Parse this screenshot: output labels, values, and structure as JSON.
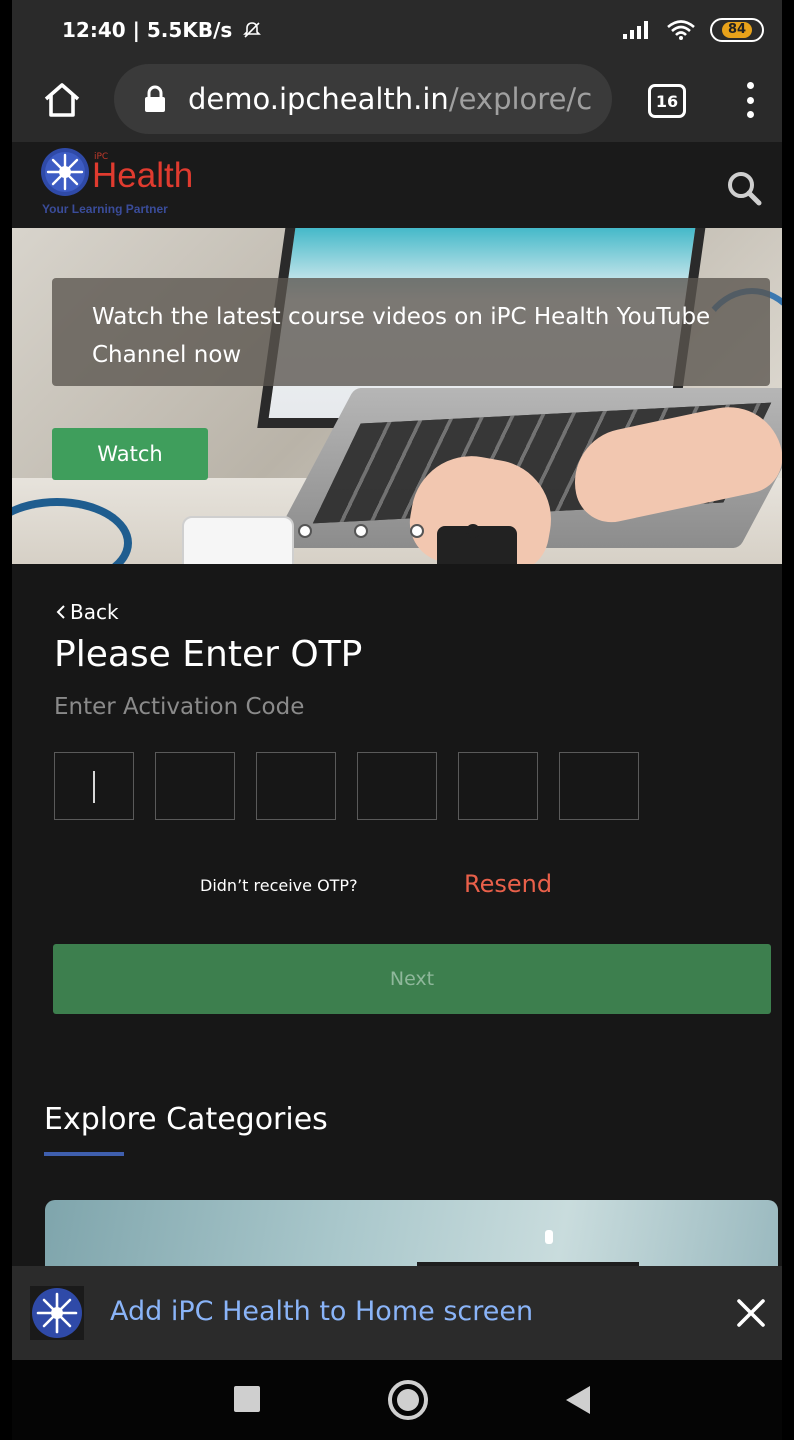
{
  "status_bar": {
    "time": "12:40 | 5.5KB/s",
    "battery": "84"
  },
  "browser": {
    "url_host": "demo.ipchealth.in",
    "url_path": "/explore/c",
    "tab_count": "16"
  },
  "site_header": {
    "brand_small": "iPC",
    "brand": "Health",
    "tagline": "Your Learning Partner"
  },
  "hero": {
    "caption": "Watch the latest course videos on iPC Health YouTube Channel now",
    "watch_label": "Watch",
    "slide_count": 4,
    "active_slide": 4
  },
  "otp": {
    "back_label": "Back",
    "title": "Please Enter OTP",
    "subtitle": "Enter Activation Code",
    "didnt_receive": "Didn’t receive OTP?",
    "resend_label": "Resend",
    "next_label": "Next"
  },
  "explore": {
    "title": "Explore Categories"
  },
  "a2hs_banner": {
    "text": "Add iPC Health to Home screen"
  },
  "colors": {
    "accent_green": "#3f9e5c",
    "next_green": "#3d7f4e",
    "resend_red": "#e9604a",
    "brand_red": "#e03b2f",
    "link_blue": "#8ab4f8",
    "underline_blue": "#3f5fae"
  }
}
